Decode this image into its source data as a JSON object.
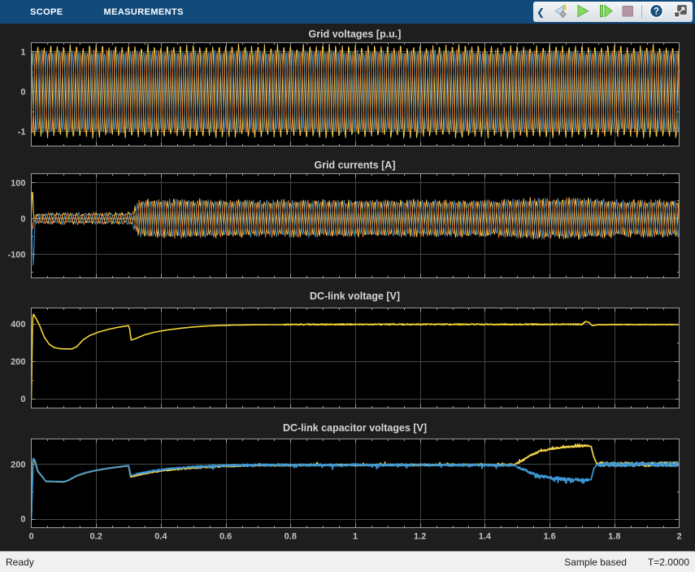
{
  "colors": {
    "toolbar_bg": "#114A7B",
    "panel_bg": "#1E1E1E",
    "plot_bg": "#000000",
    "grid_line": "#454545",
    "axis_border": "#9C9C9C",
    "tick_label": "#C2C2C2",
    "title_text": "#D6D6D6",
    "statusbar_bg": "#F0F0F0"
  },
  "toolbar": {
    "tabs": [
      {
        "label": "SCOPE"
      },
      {
        "label": "MEASUREMENTS"
      }
    ],
    "icons": [
      "collapse-chevron-icon",
      "step-back-icon",
      "run-icon",
      "step-forward-icon",
      "stop-icon",
      "help-icon",
      "dock-icon"
    ]
  },
  "statusbar": {
    "ready": "Ready",
    "sample_mode": "Sample based",
    "time": "T=2.0000"
  },
  "chart_data": [
    {
      "type": "line",
      "signal": "threephase",
      "title": "Grid voltages [p.u.]",
      "xlim": [
        0,
        2
      ],
      "ylim": [
        -1.37,
        1.22
      ],
      "grid_x_step": 0.2,
      "freq_hz": 50,
      "samples": 1150,
      "yticks": [
        {
          "v": 1,
          "label": "1"
        },
        {
          "v": 0,
          "label": "0"
        },
        {
          "v": -1,
          "label": "-1"
        }
      ],
      "envelope": [
        [
          0,
          1
        ],
        [
          2,
          1
        ]
      ],
      "jitter": [
        [
          0,
          0.05
        ],
        [
          2,
          0.05
        ]
      ],
      "series": [
        {
          "name": "phase-a",
          "color": "#F0CD4A",
          "amp": 1.13,
          "phase_deg": 90
        },
        {
          "name": "phase-b",
          "color": "#3E8DC5",
          "amp": 1.0,
          "phase_deg": -30
        },
        {
          "name": "phase-c",
          "color": "#E2772E",
          "amp": 1.0,
          "phase_deg": 210
        }
      ]
    },
    {
      "type": "line",
      "signal": "threephase",
      "title": "Grid currents [A]",
      "xlim": [
        0,
        2
      ],
      "ylim": [
        -166,
        125
      ],
      "grid_x_step": 0.2,
      "freq_hz": 50,
      "samples": 1400,
      "yticks": [
        {
          "v": 100,
          "label": "100"
        },
        {
          "v": 0,
          "label": "0"
        },
        {
          "v": -100,
          "label": "-100"
        }
      ],
      "envelope": [
        [
          0,
          2
        ],
        [
          0.008,
          2
        ],
        [
          0.015,
          13
        ],
        [
          0.29,
          13
        ],
        [
          0.31,
          16
        ],
        [
          0.335,
          48
        ],
        [
          0.45,
          50
        ],
        [
          0.7,
          47
        ],
        [
          1.45,
          47
        ],
        [
          1.55,
          52
        ],
        [
          1.72,
          52
        ],
        [
          1.8,
          47
        ],
        [
          2,
          47
        ]
      ],
      "jitter": [
        [
          0,
          0.4
        ],
        [
          0.3,
          0.4
        ],
        [
          0.34,
          0.14
        ],
        [
          2,
          0.14
        ]
      ],
      "series": [
        {
          "name": "phase-a",
          "color": "#F0CD4A",
          "amp": 1.0,
          "phase_deg": 90,
          "spike": [
            [
              0,
              0
            ],
            [
              0.0035,
              88
            ],
            [
              0.008,
              0
            ]
          ]
        },
        {
          "name": "phase-b",
          "color": "#3E8DC5",
          "amp": 1.0,
          "phase_deg": -30,
          "spike": [
            [
              0.002,
              0
            ],
            [
              0.006,
              -143
            ],
            [
              0.012,
              0
            ]
          ]
        },
        {
          "name": "phase-c",
          "color": "#E2772E",
          "amp": 1.0,
          "phase_deg": 210,
          "spike": [
            [
              0.0005,
              0
            ],
            [
              0.004,
              -30
            ],
            [
              0.009,
              0
            ]
          ]
        }
      ]
    },
    {
      "type": "line",
      "signal": "piecewise",
      "title": "DC-link voltage [V]",
      "xlim": [
        0,
        2
      ],
      "ylim": [
        -51,
        486
      ],
      "grid_x_step": 0.2,
      "samples": 1700,
      "yticks": [
        {
          "v": 400,
          "label": "400"
        },
        {
          "v": 200,
          "label": "200"
        },
        {
          "v": 0,
          "label": "0"
        }
      ],
      "series": [
        {
          "name": "vdc",
          "color": "#F5D636",
          "width": 1.6,
          "points": [
            [
              0,
              0
            ],
            [
              0.004,
              430
            ],
            [
              0.007,
              452
            ],
            [
              0.015,
              428
            ],
            [
              0.025,
              395
            ],
            [
              0.04,
              330
            ],
            [
              0.055,
              292
            ],
            [
              0.07,
              274
            ],
            [
              0.09,
              267
            ],
            [
              0.125,
              266
            ],
            [
              0.14,
              278
            ],
            [
              0.16,
              315
            ],
            [
              0.18,
              338
            ],
            [
              0.21,
              358
            ],
            [
              0.24,
              372
            ],
            [
              0.27,
              383
            ],
            [
              0.3,
              391
            ],
            [
              0.304,
              372
            ],
            [
              0.308,
              314
            ],
            [
              0.32,
              320
            ],
            [
              0.35,
              342
            ],
            [
              0.38,
              356
            ],
            [
              0.42,
              368
            ],
            [
              0.46,
              377
            ],
            [
              0.5,
              384
            ],
            [
              0.55,
              390
            ],
            [
              0.62,
              394
            ],
            [
              0.7,
              396
            ],
            [
              0.8,
              397
            ],
            [
              1.0,
              398
            ],
            [
              1.3,
              398
            ],
            [
              1.6,
              398
            ],
            [
              1.7,
              398
            ],
            [
              1.712,
              414
            ],
            [
              1.722,
              408
            ],
            [
              1.732,
              391
            ],
            [
              1.75,
              396
            ],
            [
              1.8,
              397
            ],
            [
              2,
              397
            ]
          ],
          "noise": [
            [
              0.78,
              1.71,
              3
            ],
            [
              1.75,
              2,
              1.5
            ]
          ]
        }
      ]
    },
    {
      "type": "line",
      "signal": "piecewise",
      "title": "DC-link capacitor voltages [V]",
      "xlim": [
        0,
        2
      ],
      "ylim": [
        -32,
        292
      ],
      "grid_x_step": 0.2,
      "samples": 1700,
      "yticks": [
        {
          "v": 200,
          "label": "200"
        },
        {
          "v": 0,
          "label": "0"
        }
      ],
      "xticklabels": [
        {
          "v": 0,
          "label": "0"
        },
        {
          "v": 0.2,
          "label": "0.2"
        },
        {
          "v": 0.4,
          "label": "0.4"
        },
        {
          "v": 0.6,
          "label": "0.6"
        },
        {
          "v": 0.8,
          "label": "0.8"
        },
        {
          "v": 1,
          "label": "1"
        },
        {
          "v": 1.2,
          "label": "1.2"
        },
        {
          "v": 1.4,
          "label": "1.4"
        },
        {
          "v": 1.6,
          "label": "1.6"
        },
        {
          "v": 1.8,
          "label": "1.8"
        },
        {
          "v": 2,
          "label": "2"
        }
      ],
      "series": [
        {
          "name": "vcap-upper",
          "color": "#EFD04B",
          "width": 1.8,
          "points": [
            [
              0,
              0
            ],
            [
              0.005,
              220
            ],
            [
              0.012,
              207
            ],
            [
              0.02,
              174
            ],
            [
              0.045,
              137
            ],
            [
              0.1,
              135
            ],
            [
              0.115,
              141
            ],
            [
              0.14,
              157
            ],
            [
              0.17,
              169
            ],
            [
              0.2,
              177
            ],
            [
              0.24,
              185
            ],
            [
              0.28,
              191
            ],
            [
              0.3,
              194
            ],
            [
              0.307,
              153
            ],
            [
              0.33,
              161
            ],
            [
              0.37,
              170
            ],
            [
              0.41,
              177
            ],
            [
              0.46,
              183
            ],
            [
              0.52,
              188
            ],
            [
              0.6,
              193
            ],
            [
              0.7,
              196
            ],
            [
              0.9,
              197
            ],
            [
              1.2,
              197
            ],
            [
              1.49,
              198
            ],
            [
              1.515,
              212
            ],
            [
              1.54,
              232
            ],
            [
              1.57,
              247
            ],
            [
              1.61,
              257
            ],
            [
              1.65,
              263
            ],
            [
              1.69,
              266
            ],
            [
              1.715,
              267
            ],
            [
              1.728,
              265
            ],
            [
              1.736,
              228
            ],
            [
              1.745,
              203
            ],
            [
              1.76,
              200
            ],
            [
              2,
              200
            ]
          ],
          "noise": [
            [
              0.32,
              0.55,
              2.5
            ],
            [
              0.55,
              1.49,
              3
            ],
            [
              1.5,
              1.72,
              3
            ],
            [
              1.75,
              2,
              8
            ]
          ],
          "spike_noise": [
            [
              0.55,
              1.49,
              8,
              0.02,
              1
            ],
            [
              1.5,
              1.72,
              8,
              0.05,
              1
            ]
          ]
        },
        {
          "name": "vcap-lower",
          "color": "#3E97D4",
          "width": 1.8,
          "points": [
            [
              0,
              0
            ],
            [
              0.006,
              223
            ],
            [
              0.013,
              209
            ],
            [
              0.02,
              176
            ],
            [
              0.045,
              138
            ],
            [
              0.1,
              136
            ],
            [
              0.115,
              142
            ],
            [
              0.14,
              158
            ],
            [
              0.17,
              170
            ],
            [
              0.2,
              178
            ],
            [
              0.24,
              186
            ],
            [
              0.28,
              192
            ],
            [
              0.3,
              195
            ],
            [
              0.308,
              158
            ],
            [
              0.33,
              166
            ],
            [
              0.37,
              174
            ],
            [
              0.41,
              181
            ],
            [
              0.46,
              187
            ],
            [
              0.52,
              192
            ],
            [
              0.6,
              195
            ],
            [
              0.7,
              197
            ],
            [
              0.9,
              197
            ],
            [
              1.2,
              197
            ],
            [
              1.49,
              196
            ],
            [
              1.515,
              183
            ],
            [
              1.54,
              168
            ],
            [
              1.57,
              157
            ],
            [
              1.61,
              150
            ],
            [
              1.65,
              146
            ],
            [
              1.69,
              143
            ],
            [
              1.715,
              142
            ],
            [
              1.728,
              143
            ],
            [
              1.737,
              185
            ],
            [
              1.746,
              197
            ],
            [
              1.76,
              199
            ],
            [
              2,
              199
            ]
          ],
          "noise": [
            [
              0.32,
              0.55,
              2.5
            ],
            [
              0.55,
              1.49,
              4
            ],
            [
              1.5,
              1.72,
              5
            ],
            [
              1.75,
              2,
              8
            ]
          ],
          "spike_noise": [
            [
              0.5,
              1.49,
              12,
              0.025,
              -1
            ],
            [
              1.53,
              1.72,
              16,
              0.08,
              -1
            ]
          ]
        }
      ]
    }
  ]
}
